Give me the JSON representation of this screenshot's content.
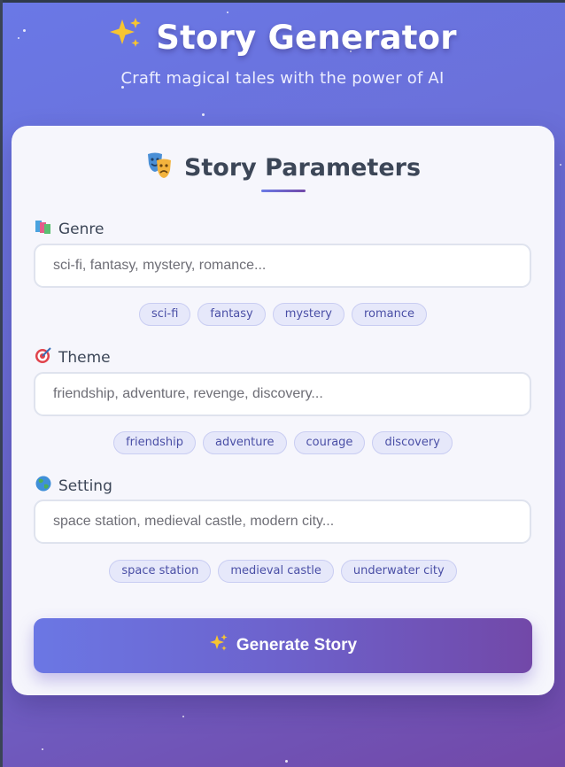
{
  "header": {
    "title": "Story Generator",
    "subtitle": "Craft magical tales with the power of AI"
  },
  "card": {
    "title": "Story Parameters",
    "fields": [
      {
        "label": "Genre",
        "placeholder": "sci-fi, fantasy, mystery, romance...",
        "value": "",
        "chips": [
          "sci-fi",
          "fantasy",
          "mystery",
          "romance"
        ]
      },
      {
        "label": "Theme",
        "placeholder": "friendship, adventure, revenge, discovery...",
        "value": "",
        "chips": [
          "friendship",
          "adventure",
          "courage",
          "discovery"
        ]
      },
      {
        "label": "Setting",
        "placeholder": "space station, medieval castle, modern city...",
        "value": "",
        "chips": [
          "space station",
          "medieval castle",
          "underwater city"
        ]
      }
    ],
    "generate_label": "Generate Story"
  },
  "icons": {
    "title": "sparkles-icon",
    "card_title": "theater-masks-icon",
    "genre": "books-icon",
    "theme": "target-icon",
    "setting": "globe-icon",
    "generate": "sparkles-icon"
  },
  "colors": {
    "background_start": "#6a78e6",
    "background_end": "#7248a8",
    "card": "#f6f6fc",
    "heading": "#3c4657",
    "chip_bg": "#e6e8fa",
    "chip_text": "#4a4fa6"
  }
}
